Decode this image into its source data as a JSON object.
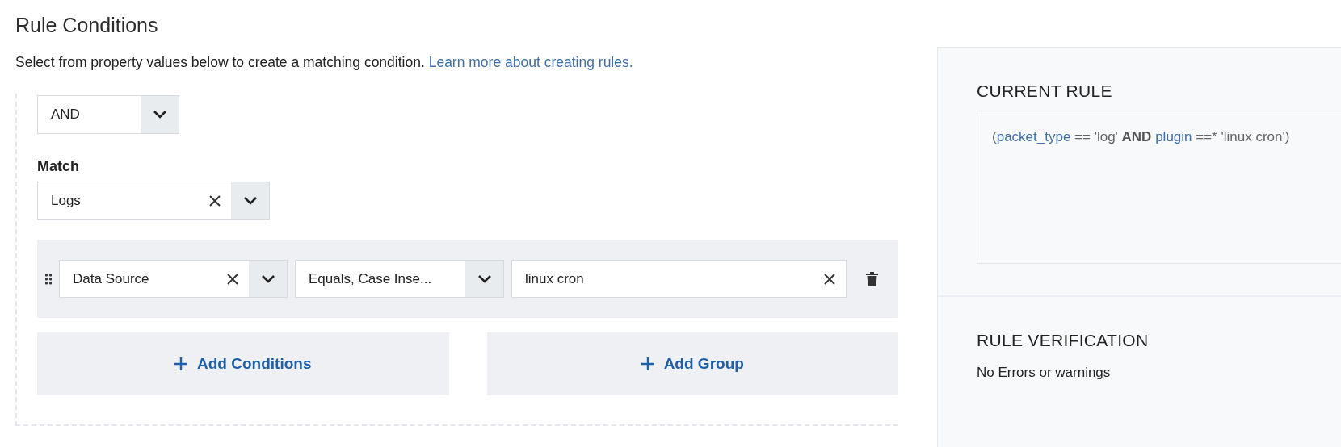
{
  "heading": "Rule Conditions",
  "description": {
    "text": "Select from property values below to create a matching condition.",
    "link": "Learn more about creating rules."
  },
  "operator_select": {
    "value": "AND"
  },
  "match": {
    "label": "Match",
    "value": "Logs"
  },
  "conditions": [
    {
      "property": "Data Source",
      "comparator": "Equals, Case Inse...",
      "value": "linux cron"
    }
  ],
  "buttons": [
    {
      "label": "Add Conditions"
    },
    {
      "label": "Add Group"
    }
  ],
  "current_rule": {
    "title": "CURRENT RULE",
    "tokens": [
      {
        "kind": "plain",
        "text": "("
      },
      {
        "kind": "field",
        "text": "packet_type"
      },
      {
        "kind": "plain",
        "text": " == 'log' "
      },
      {
        "kind": "keyword",
        "text": "AND"
      },
      {
        "kind": "field",
        "text": "plugin"
      },
      {
        "kind": "plain",
        "text": " ==* 'linux cron')"
      }
    ]
  },
  "verification": {
    "title": "RULE VERIFICATION",
    "message": "No Errors or warnings"
  }
}
